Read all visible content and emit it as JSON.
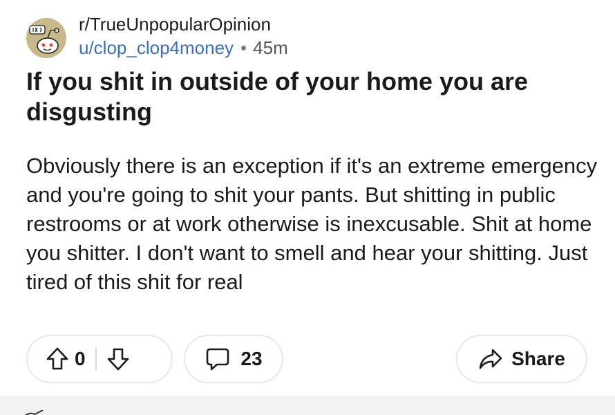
{
  "post": {
    "subreddit": "r/TrueUnpopularOpinion",
    "author": "u/clop_clop4money",
    "separator": "•",
    "time_ago": "45m",
    "title": "If you shit in outside of your home you are disgusting",
    "body": "Obviously there is an exception if it's an extreme emergency and you're going to shit your pants. But shitting in public restrooms or at work otherwise is inexcusable. Shit at home you shitter. I don't want to smell and hear your shitting. Just tired of this shit for real"
  },
  "actions": {
    "vote_count": "0",
    "comment_count": "23",
    "share_label": "Share"
  },
  "icons": {
    "avatar": "subreddit-avatar-icon",
    "upvote": "upvote-arrow-icon",
    "downvote": "downvote-arrow-icon",
    "comment": "comment-bubble-icon",
    "share": "share-arrow-icon"
  },
  "colors": {
    "author_link": "#3b6fb6",
    "text": "#1a1a1b",
    "muted": "#555555",
    "pill_border": "#e7e7e7",
    "avatar_bg": "#c9b98a",
    "separator_band": "#f2f2f3"
  }
}
